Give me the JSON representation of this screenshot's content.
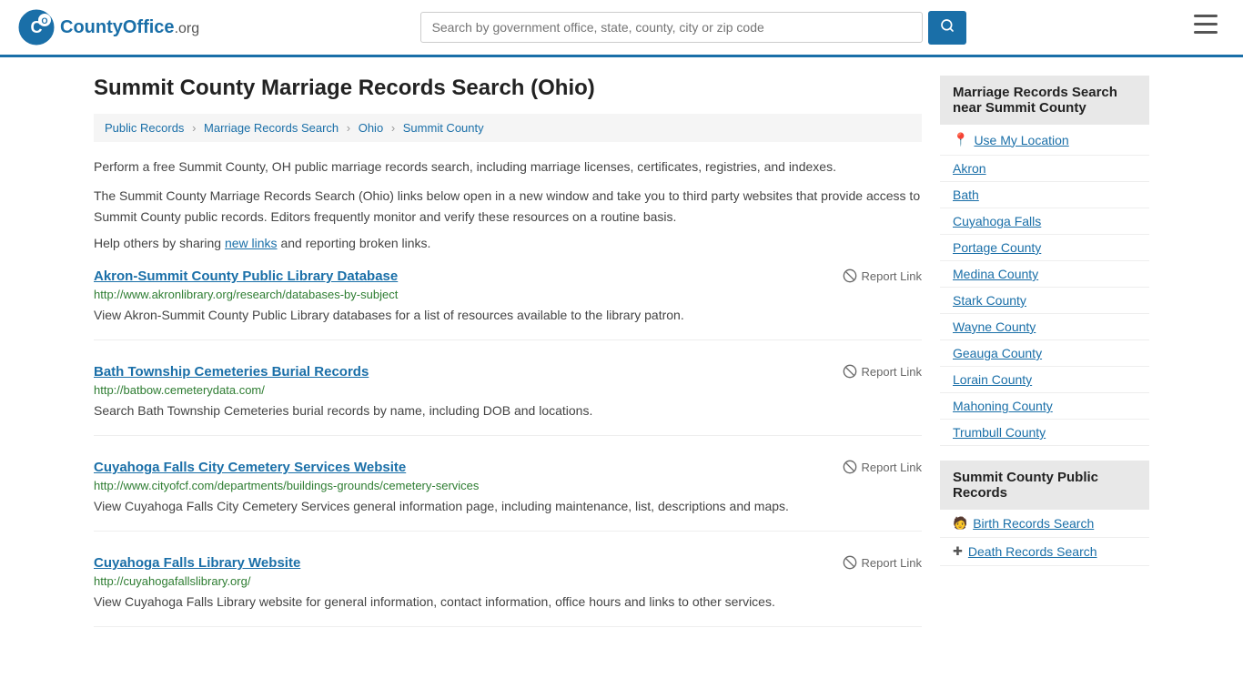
{
  "header": {
    "logo_text": "CountyOffice",
    "logo_suffix": ".org",
    "search_placeholder": "Search by government office, state, county, city or zip code"
  },
  "page": {
    "title": "Summit County Marriage Records Search (Ohio)",
    "breadcrumb": [
      {
        "label": "Public Records",
        "href": "#"
      },
      {
        "label": "Marriage Records Search",
        "href": "#"
      },
      {
        "label": "Ohio",
        "href": "#"
      },
      {
        "label": "Summit County",
        "href": "#"
      }
    ],
    "description1": "Perform a free Summit County, OH public marriage records search, including marriage licenses, certificates, registries, and indexes.",
    "description2": "The Summit County Marriage Records Search (Ohio) links below open in a new window and take you to third party websites that provide access to Summit County public records. Editors frequently monitor and verify these resources on a routine basis.",
    "help_text_prefix": "Help others by sharing ",
    "help_link_text": "new links",
    "help_text_suffix": " and reporting broken links."
  },
  "results": [
    {
      "title": "Akron-Summit County Public Library Database",
      "url": "http://www.akronlibrary.org/research/databases-by-subject",
      "description": "View Akron-Summit County Public Library databases for a list of resources available to the library patron."
    },
    {
      "title": "Bath Township Cemeteries Burial Records",
      "url": "http://batbow.cemeterydata.com/",
      "description": "Search Bath Township Cemeteries burial records by name, including DOB and locations."
    },
    {
      "title": "Cuyahoga Falls City Cemetery Services Website",
      "url": "http://www.cityofcf.com/departments/buildings-grounds/cemetery-services",
      "description": "View Cuyahoga Falls City Cemetery Services general information page, including maintenance, list, descriptions and maps."
    },
    {
      "title": "Cuyahoga Falls Library Website",
      "url": "http://cuyahogafallslibrary.org/",
      "description": "View Cuyahoga Falls Library website for general information, contact information, office hours and links to other services."
    }
  ],
  "report_label": "Report Link",
  "sidebar": {
    "nearby_header": "Marriage Records Search near Summit County",
    "use_my_location": "Use My Location",
    "nearby_links": [
      "Akron",
      "Bath",
      "Cuyahoga Falls",
      "Portage County",
      "Medina County",
      "Stark County",
      "Wayne County",
      "Geauga County",
      "Lorain County",
      "Mahoning County",
      "Trumbull County"
    ],
    "public_records_header": "Summit County Public Records",
    "public_records_links": [
      {
        "label": "Birth Records Search",
        "icon": "person"
      },
      {
        "label": "Death Records Search",
        "icon": "cross"
      }
    ]
  }
}
